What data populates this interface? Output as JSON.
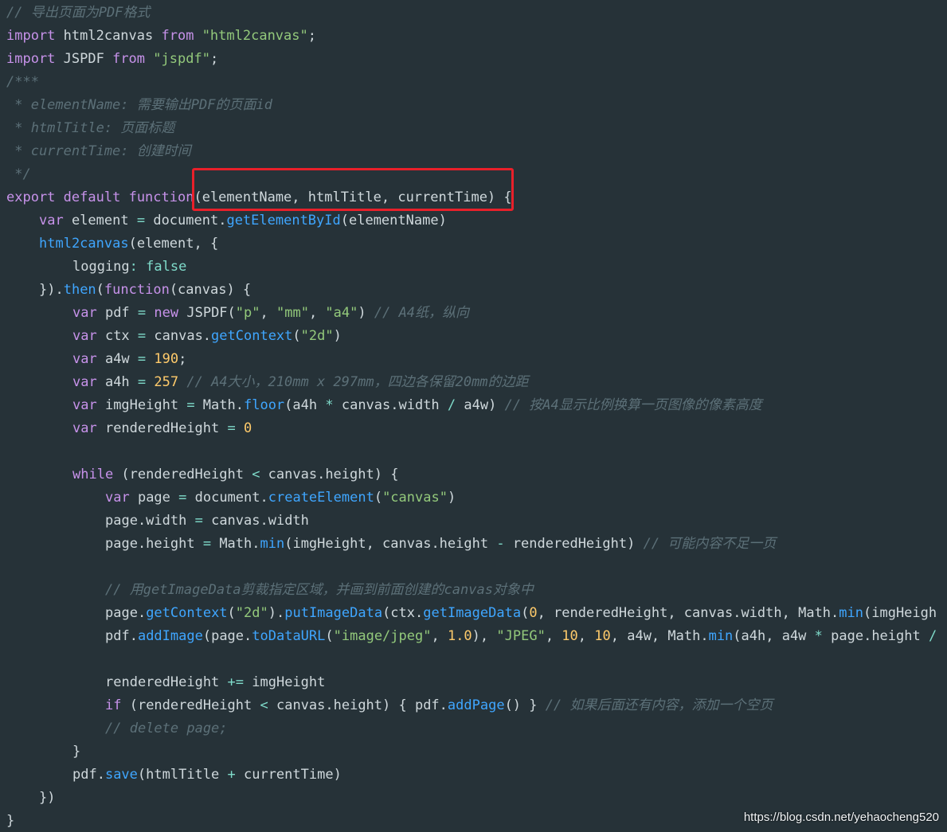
{
  "code": {
    "lines": [
      [
        {
          "t": "// 导出页面为PDF格式",
          "c": "c"
        }
      ],
      [
        {
          "t": "import",
          "c": "k"
        },
        {
          "t": " html2canvas ",
          "c": "p"
        },
        {
          "t": "from",
          "c": "k"
        },
        {
          "t": " ",
          "c": "p"
        },
        {
          "t": "\"html2canvas\"",
          "c": "s"
        },
        {
          "t": ";",
          "c": "p"
        }
      ],
      [
        {
          "t": "import",
          "c": "k"
        },
        {
          "t": " JSPDF ",
          "c": "p"
        },
        {
          "t": "from",
          "c": "k"
        },
        {
          "t": " ",
          "c": "p"
        },
        {
          "t": "\"jspdf\"",
          "c": "s"
        },
        {
          "t": ";",
          "c": "p"
        }
      ],
      [
        {
          "t": "/***",
          "c": "c"
        }
      ],
      [
        {
          "t": " * elementName: 需要输出PDF的页面id",
          "c": "c"
        }
      ],
      [
        {
          "t": " * htmlTitle: 页面标题",
          "c": "c"
        }
      ],
      [
        {
          "t": " * currentTime: 创建时间",
          "c": "c"
        }
      ],
      [
        {
          "t": " */",
          "c": "c"
        }
      ],
      [
        {
          "t": "export",
          "c": "k"
        },
        {
          "t": " ",
          "c": "p"
        },
        {
          "t": "default",
          "c": "k"
        },
        {
          "t": " ",
          "c": "p"
        },
        {
          "t": "function",
          "c": "k"
        },
        {
          "t": "(elementName, htmlTitle, currentTime) {",
          "c": "p"
        }
      ],
      [
        {
          "t": "var",
          "c": "k"
        },
        {
          "t": " element ",
          "c": "p"
        },
        {
          "t": "=",
          "c": "o"
        },
        {
          "t": " document.",
          "c": "p"
        },
        {
          "t": "getElementById",
          "c": "f"
        },
        {
          "t": "(elementName)",
          "c": "p"
        }
      ],
      [
        {
          "t": "html2canvas",
          "c": "f"
        },
        {
          "t": "(element, {",
          "c": "p"
        }
      ],
      [
        {
          "t": "logging",
          "c": "p"
        },
        {
          "t": ":",
          "c": "o"
        },
        {
          "t": " ",
          "c": "p"
        },
        {
          "t": "false",
          "c": "o"
        }
      ],
      [
        {
          "t": "}).",
          "c": "p"
        },
        {
          "t": "then",
          "c": "f"
        },
        {
          "t": "(",
          "c": "p"
        },
        {
          "t": "function",
          "c": "k"
        },
        {
          "t": "(canvas) {",
          "c": "p"
        }
      ],
      [
        {
          "t": "var",
          "c": "k"
        },
        {
          "t": " pdf ",
          "c": "p"
        },
        {
          "t": "=",
          "c": "o"
        },
        {
          "t": " ",
          "c": "p"
        },
        {
          "t": "new",
          "c": "k"
        },
        {
          "t": " JSPDF(",
          "c": "p"
        },
        {
          "t": "\"p\"",
          "c": "s"
        },
        {
          "t": ", ",
          "c": "p"
        },
        {
          "t": "\"mm\"",
          "c": "s"
        },
        {
          "t": ", ",
          "c": "p"
        },
        {
          "t": "\"a4\"",
          "c": "s"
        },
        {
          "t": ") ",
          "c": "p"
        },
        {
          "t": "// A4纸，纵向",
          "c": "c"
        }
      ],
      [
        {
          "t": "var",
          "c": "k"
        },
        {
          "t": " ctx ",
          "c": "p"
        },
        {
          "t": "=",
          "c": "o"
        },
        {
          "t": " canvas.",
          "c": "p"
        },
        {
          "t": "getContext",
          "c": "f"
        },
        {
          "t": "(",
          "c": "p"
        },
        {
          "t": "\"2d\"",
          "c": "s"
        },
        {
          "t": ")",
          "c": "p"
        }
      ],
      [
        {
          "t": "var",
          "c": "k"
        },
        {
          "t": " a4w ",
          "c": "p"
        },
        {
          "t": "=",
          "c": "o"
        },
        {
          "t": " ",
          "c": "p"
        },
        {
          "t": "190",
          "c": "b"
        },
        {
          "t": ";",
          "c": "p"
        }
      ],
      [
        {
          "t": "var",
          "c": "k"
        },
        {
          "t": " a4h ",
          "c": "p"
        },
        {
          "t": "=",
          "c": "o"
        },
        {
          "t": " ",
          "c": "p"
        },
        {
          "t": "257",
          "c": "b"
        },
        {
          "t": " ",
          "c": "p"
        },
        {
          "t": "// A4大小，210mm x 297mm，四边各保留20mm的边距",
          "c": "c"
        }
      ],
      [
        {
          "t": "var",
          "c": "k"
        },
        {
          "t": " imgHeight ",
          "c": "p"
        },
        {
          "t": "=",
          "c": "o"
        },
        {
          "t": " Math.",
          "c": "p"
        },
        {
          "t": "floor",
          "c": "f"
        },
        {
          "t": "(a4h ",
          "c": "p"
        },
        {
          "t": "*",
          "c": "o"
        },
        {
          "t": " canvas.width ",
          "c": "p"
        },
        {
          "t": "/",
          "c": "o"
        },
        {
          "t": " a4w) ",
          "c": "p"
        },
        {
          "t": "// 按A4显示比例换算一页图像的像素高度",
          "c": "c"
        }
      ],
      [
        {
          "t": "var",
          "c": "k"
        },
        {
          "t": " renderedHeight ",
          "c": "p"
        },
        {
          "t": "=",
          "c": "o"
        },
        {
          "t": " ",
          "c": "p"
        },
        {
          "t": "0",
          "c": "b"
        }
      ],
      [],
      [
        {
          "t": "while",
          "c": "k"
        },
        {
          "t": " (renderedHeight ",
          "c": "p"
        },
        {
          "t": "<",
          "c": "o"
        },
        {
          "t": " canvas.height) {",
          "c": "p"
        }
      ],
      [
        {
          "t": "var",
          "c": "k"
        },
        {
          "t": " page ",
          "c": "p"
        },
        {
          "t": "=",
          "c": "o"
        },
        {
          "t": " document.",
          "c": "p"
        },
        {
          "t": "createElement",
          "c": "f"
        },
        {
          "t": "(",
          "c": "p"
        },
        {
          "t": "\"canvas\"",
          "c": "s"
        },
        {
          "t": ")",
          "c": "p"
        }
      ],
      [
        {
          "t": "page.width ",
          "c": "p"
        },
        {
          "t": "=",
          "c": "o"
        },
        {
          "t": " canvas.width",
          "c": "p"
        }
      ],
      [
        {
          "t": "page.height ",
          "c": "p"
        },
        {
          "t": "=",
          "c": "o"
        },
        {
          "t": " Math.",
          "c": "p"
        },
        {
          "t": "min",
          "c": "f"
        },
        {
          "t": "(imgHeight, canvas.height ",
          "c": "p"
        },
        {
          "t": "-",
          "c": "o"
        },
        {
          "t": " renderedHeight) ",
          "c": "p"
        },
        {
          "t": "// 可能内容不足一页",
          "c": "c"
        }
      ],
      [],
      [
        {
          "t": "// 用getImageData剪裁指定区域，并画到前面创建的canvas对象中",
          "c": "c"
        }
      ],
      [
        {
          "t": "page.",
          "c": "p"
        },
        {
          "t": "getContext",
          "c": "f"
        },
        {
          "t": "(",
          "c": "p"
        },
        {
          "t": "\"2d\"",
          "c": "s"
        },
        {
          "t": ").",
          "c": "p"
        },
        {
          "t": "putImageData",
          "c": "f"
        },
        {
          "t": "(ctx.",
          "c": "p"
        },
        {
          "t": "getImageData",
          "c": "f"
        },
        {
          "t": "(",
          "c": "p"
        },
        {
          "t": "0",
          "c": "b"
        },
        {
          "t": ", renderedHeight, canvas.width, Math.",
          "c": "p"
        },
        {
          "t": "min",
          "c": "f"
        },
        {
          "t": "(imgHeigh",
          "c": "p"
        }
      ],
      [
        {
          "t": "pdf.",
          "c": "p"
        },
        {
          "t": "addImage",
          "c": "f"
        },
        {
          "t": "(page.",
          "c": "p"
        },
        {
          "t": "toDataURL",
          "c": "f"
        },
        {
          "t": "(",
          "c": "p"
        },
        {
          "t": "\"image/jpeg\"",
          "c": "s"
        },
        {
          "t": ", ",
          "c": "p"
        },
        {
          "t": "1.0",
          "c": "b"
        },
        {
          "t": "), ",
          "c": "p"
        },
        {
          "t": "\"JPEG\"",
          "c": "s"
        },
        {
          "t": ", ",
          "c": "p"
        },
        {
          "t": "10",
          "c": "b"
        },
        {
          "t": ", ",
          "c": "p"
        },
        {
          "t": "10",
          "c": "b"
        },
        {
          "t": ", a4w, Math.",
          "c": "p"
        },
        {
          "t": "min",
          "c": "f"
        },
        {
          "t": "(a4h, a4w ",
          "c": "p"
        },
        {
          "t": "*",
          "c": "o"
        },
        {
          "t": " page.height ",
          "c": "p"
        },
        {
          "t": "/",
          "c": "o"
        }
      ],
      [],
      [
        {
          "t": "renderedHeight ",
          "c": "p"
        },
        {
          "t": "+=",
          "c": "o"
        },
        {
          "t": " imgHeight",
          "c": "p"
        }
      ],
      [
        {
          "t": "if",
          "c": "k"
        },
        {
          "t": " (renderedHeight ",
          "c": "p"
        },
        {
          "t": "<",
          "c": "o"
        },
        {
          "t": " canvas.height) { pdf.",
          "c": "p"
        },
        {
          "t": "addPage",
          "c": "f"
        },
        {
          "t": "() } ",
          "c": "p"
        },
        {
          "t": "// 如果后面还有内容，添加一个空页",
          "c": "c"
        }
      ],
      [
        {
          "t": "// delete page;",
          "c": "c"
        }
      ],
      [
        {
          "t": "}",
          "c": "p"
        }
      ],
      [
        {
          "t": "pdf.",
          "c": "p"
        },
        {
          "t": "save",
          "c": "f"
        },
        {
          "t": "(htmlTitle ",
          "c": "p"
        },
        {
          "t": "+",
          "c": "o"
        },
        {
          "t": " currentTime)",
          "c": "p"
        }
      ],
      [
        {
          "t": "})",
          "c": "p"
        }
      ],
      [
        {
          "t": "}",
          "c": "p"
        }
      ]
    ]
  },
  "watermark": "https://blog.csdn.net/yehaocheng520",
  "colors": {
    "background": "#263238",
    "highlight_border": "#e8202a"
  }
}
